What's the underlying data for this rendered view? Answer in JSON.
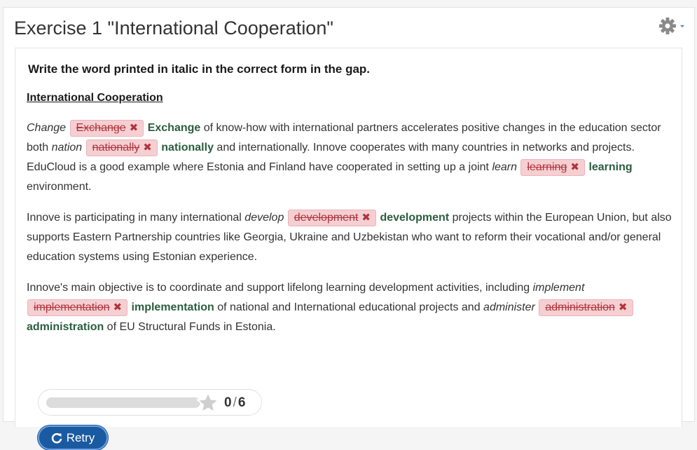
{
  "header": {
    "title": "Exercise 1 \"International Cooperation\"",
    "settings_icon": "gear-icon"
  },
  "task": {
    "instructions": "Write the word printed in italic in the correct form in the gap.",
    "subtitle": "International Cooperation"
  },
  "paragraphs": {
    "p1": {
      "cue1": "Change",
      "gap1_wrong": "Exchange",
      "gap1_correct": "Exchange",
      "text1": " of know-how with international partners accelerates positive changes in the education sector both ",
      "cue2": "nation",
      "gap2_wrong": "nationally",
      "gap2_correct": "nationally",
      "text2": " and internationally. Innove cooperates with many countries in networks and projects. EduCloud is a good example where Estonia and Finland have cooperated in setting up a joint ",
      "cue3": "learn",
      "gap3_wrong": "learning",
      "gap3_correct": "learning",
      "text3": " environment."
    },
    "p2": {
      "text0": "Innove is participating in many international ",
      "cue1": "develop",
      "gap1_wrong": "development",
      "gap1_correct": "development",
      "text1": " projects within the European Union, but also supports Eastern Partnership countries like Georgia, Ukraine and Uzbekistan who want to reform their vocational and/or general education systems using Estonian experience."
    },
    "p3": {
      "text0": "Innove's main objective is to coordinate and support lifelong learning development activities, including ",
      "cue1": "implement",
      "gap1_wrong": "implementation",
      "gap1_correct": "implementation",
      "text1": " of national and International educational projects and ",
      "cue2": "administer",
      "gap2_wrong": "administration",
      "gap2_correct": "administration",
      "text2": " of EU Structural Funds in Estonia."
    }
  },
  "score": {
    "current": "0",
    "separator": "/",
    "total": "6",
    "progress": 0
  },
  "actions": {
    "retry_label": "Retry"
  },
  "colors": {
    "wrong_bg": "#f5cfd2",
    "wrong_text": "#b0343d",
    "correct_text": "#2c5d3f",
    "button_bg": "#1a5aa0"
  }
}
